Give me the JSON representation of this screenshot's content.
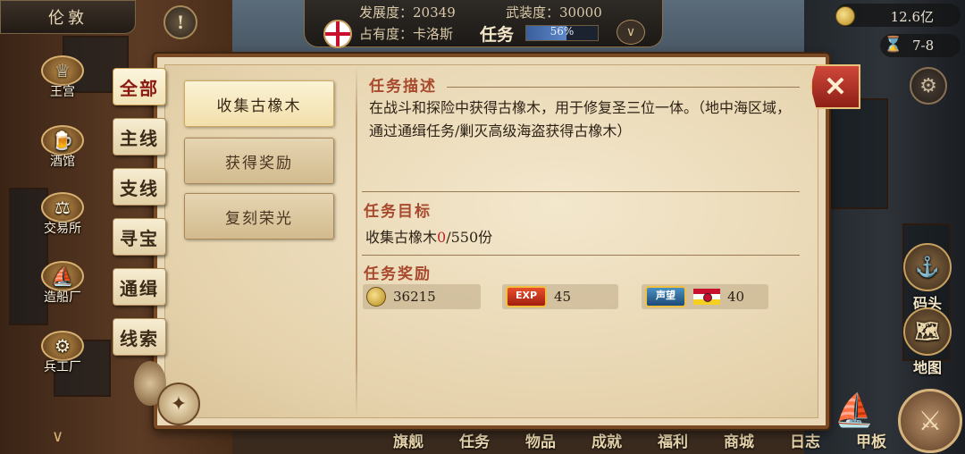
{
  "top": {
    "city": "伦敦",
    "alert_icon": "!",
    "development_label": "发展度：",
    "development_value": "20349",
    "armament_label": "武装度：",
    "armament_value": "30000",
    "occupancy_label": "占有度：卡洛斯",
    "task_label": "任务",
    "task_progress_text": "56%",
    "task_progress": 0.56,
    "gold": "12.6亿",
    "time_range": "7-8"
  },
  "left_nav": {
    "palace": "王宫",
    "tavern": "酒馆",
    "exchange": "交易所",
    "shipyard": "造船厂",
    "arsenal": "兵工厂"
  },
  "right_nav": {
    "dock": "码头",
    "map": "地图"
  },
  "bottom_nav": [
    "旗舰",
    "任务",
    "物品",
    "成就",
    "福利",
    "商城",
    "日志",
    "甲板"
  ],
  "categories": [
    "全部",
    "主线",
    "支线",
    "寻宝",
    "通缉",
    "线索"
  ],
  "active_category": 0,
  "quests": [
    "收集古橡木",
    "获得奖励",
    "复刻荣光"
  ],
  "active_quest": 0,
  "detail": {
    "desc_title": "任务描述",
    "desc_text": "在战斗和探险中获得古橡木，用于修复圣三位一体。（地中海区域，通过通缉任务/剿灭高级海盗获得古橡木）",
    "goal_title": "任务目标",
    "goal_prefix": "收集古橡木",
    "goal_current": "0",
    "goal_suffix": "/550份",
    "reward_title": "任务奖励",
    "reward_gold": "36215",
    "reward_exp_badge": "EXP",
    "reward_exp": "45",
    "reward_rep_badge": "声望",
    "reward_rep": "40"
  },
  "colors": {
    "accent_red": "#a8492e",
    "close_red": "#c0392b",
    "parchment": "#e9d9b8",
    "task_bar": "#3a5f9c"
  }
}
